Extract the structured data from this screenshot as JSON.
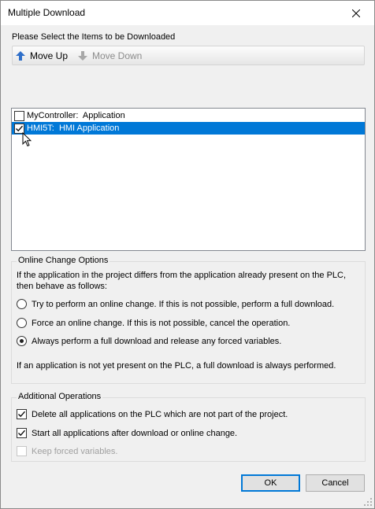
{
  "window": {
    "title": "Multiple Download"
  },
  "prompt": "Please Select the Items to be Downloaded",
  "toolbar": {
    "move_up_label": "Move Up",
    "move_down_label": "Move Down"
  },
  "items": [
    {
      "label": "MyController:  Application",
      "checked": false,
      "selected": false
    },
    {
      "label": "HMI5T:  HMI Application",
      "checked": true,
      "selected": true
    }
  ],
  "online_change": {
    "title": "Online Change Options",
    "description_line1": "If the application in the project differs from the application already present on the PLC,",
    "description_line2": "then behave as follows:",
    "options": [
      {
        "label": "Try to perform an online change. If this is not possible, perform a full download.",
        "selected": false
      },
      {
        "label": "Force an online change. If this is not possible, cancel the operation.",
        "selected": false
      },
      {
        "label": "Always perform a full download and release any forced variables.",
        "selected": true
      }
    ],
    "note": "If an application is not yet present on the PLC, a full download is always performed."
  },
  "additional": {
    "title": "Additional Operations",
    "options": [
      {
        "label": "Delete all applications on the PLC which are not part of the project.",
        "checked": true,
        "enabled": true
      },
      {
        "label": "Start all applications after download or online change.",
        "checked": true,
        "enabled": true
      },
      {
        "label": "Keep forced variables.",
        "checked": false,
        "enabled": false
      }
    ]
  },
  "buttons": {
    "ok_label": "OK",
    "cancel_label": "Cancel"
  },
  "colors": {
    "selection": "#0078d7",
    "move_up_arrow": "#2f6fc9",
    "disabled_text": "#8c8c8c"
  }
}
